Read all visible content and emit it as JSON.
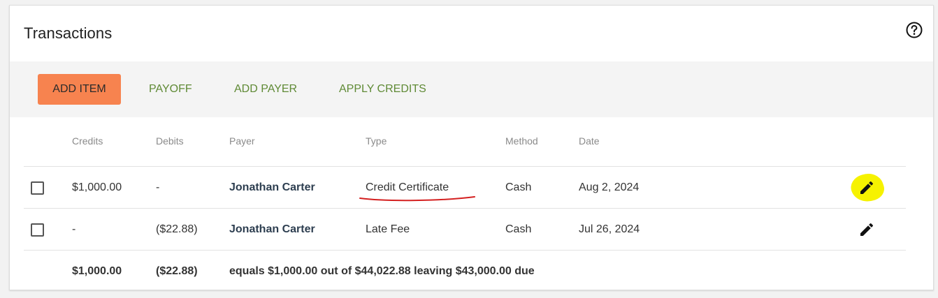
{
  "header": {
    "title": "Transactions",
    "help_icon": "help-circle-icon"
  },
  "toolbar": {
    "add_item_label": "ADD ITEM",
    "payoff_label": "PAYOFF",
    "add_payer_label": "ADD PAYER",
    "apply_credits_label": "APPLY CREDITS",
    "primary_color": "#f7834f",
    "link_color": "#5f8a35"
  },
  "table": {
    "columns": [
      "Credits",
      "Debits",
      "Payer",
      "Type",
      "Method",
      "Date"
    ],
    "rows": [
      {
        "checked": false,
        "credits": "$1,000.00",
        "debits": "-",
        "payer": "Jonathan Carter",
        "type": "Credit Certificate",
        "method": "Cash",
        "date": "Aug 2, 2024",
        "edit_icon": "pencil-icon",
        "edit_highlighted": true
      },
      {
        "checked": false,
        "credits": "-",
        "debits": "($22.88)",
        "payer": "Jonathan Carter",
        "type": "Late Fee",
        "method": "Cash",
        "date": "Jul 26, 2024",
        "edit_icon": "pencil-icon",
        "edit_highlighted": false
      }
    ],
    "totals": {
      "credits": "$1,000.00",
      "debits": "($22.88)",
      "summary": "equals $1,000.00 out of $44,022.88 leaving $43,000.00 due"
    }
  },
  "annotations": {
    "highlight_color": "#f6f200",
    "underline_color": "#d42020"
  }
}
